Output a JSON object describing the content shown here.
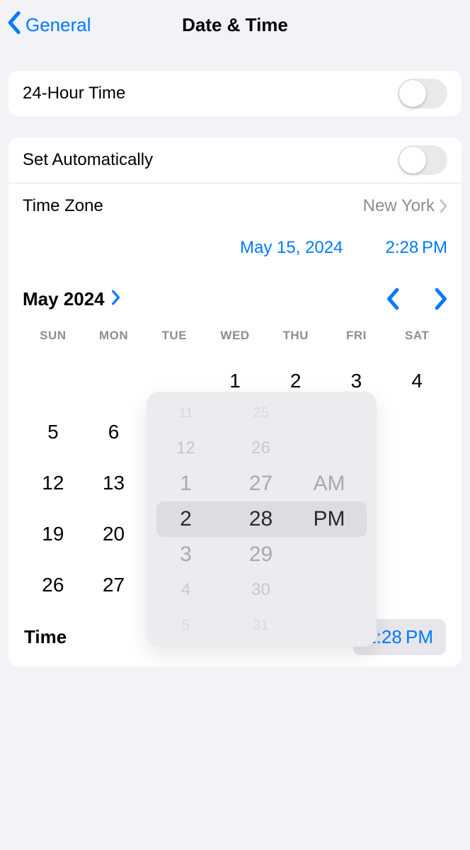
{
  "nav": {
    "back_label": "General",
    "title": "Date & Time"
  },
  "groups": {
    "hour24_label": "24-Hour Time",
    "set_auto_label": "Set Automatically",
    "timezone_label": "Time Zone",
    "timezone_value": "New York",
    "date_display": "May 15, 2024",
    "time_display": "2:28 PM"
  },
  "calendar": {
    "month_title": "May 2024",
    "weekdays": [
      "SUN",
      "MON",
      "TUE",
      "WED",
      "THU",
      "FRI",
      "SAT"
    ],
    "rows": [
      [
        "",
        "",
        "",
        "1",
        "2",
        "3",
        "4"
      ],
      [
        "5",
        "6",
        "",
        "",
        "",
        "",
        ""
      ],
      [
        "12",
        "13",
        "",
        "",
        "",
        "",
        ""
      ],
      [
        "19",
        "20",
        "",
        "",
        "",
        "",
        ""
      ],
      [
        "26",
        "27",
        "",
        "",
        "",
        "",
        ""
      ]
    ]
  },
  "picker": {
    "hour": {
      "vfar_above": "11",
      "far_above": "12",
      "above": "1",
      "selected": "2",
      "below": "3",
      "far_below": "4",
      "vfar_below": "5"
    },
    "minute": {
      "vfar_above": "25",
      "far_above": "26",
      "above": "27",
      "selected": "28",
      "below": "29",
      "far_below": "30",
      "vfar_below": "31"
    },
    "ampm": {
      "above": "AM",
      "selected": "PM"
    }
  },
  "time_row": {
    "label": "Time",
    "value": "2:28 PM"
  }
}
